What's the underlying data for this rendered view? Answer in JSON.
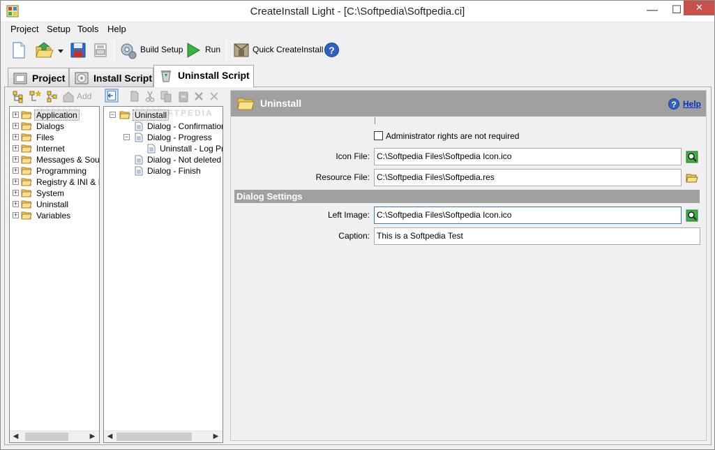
{
  "window": {
    "title": "CreateInstall Light - [C:\\Softpedia\\Softpedia.ci]",
    "min_glyph": "—",
    "max_glyph": "☐",
    "close_glyph": "✕"
  },
  "menu": [
    "Project",
    "Setup",
    "Tools",
    "Help"
  ],
  "toolbar": {
    "build_setup": "Build Setup",
    "run": "Run",
    "quick_createinstall": "Quick CreateInstall"
  },
  "tabs": [
    {
      "label": "Project",
      "active": false
    },
    {
      "label": "Install Script",
      "active": false
    },
    {
      "label": "Uninstall Script",
      "active": true
    }
  ],
  "left_toolbar": {
    "add_label": "Add"
  },
  "command_tree": [
    {
      "label": "Application",
      "selected": true
    },
    {
      "label": "Dialogs"
    },
    {
      "label": "Files"
    },
    {
      "label": "Internet"
    },
    {
      "label": "Messages & Sounds"
    },
    {
      "label": "Programming"
    },
    {
      "label": "Registry & INI & Environment"
    },
    {
      "label": "System"
    },
    {
      "label": "Uninstall"
    },
    {
      "label": "Variables"
    }
  ],
  "script_tree": {
    "root": "Uninstall",
    "watermark": "SOFTPEDIA",
    "items": [
      {
        "label": "Dialog - Confirmation",
        "level": 1
      },
      {
        "label": "Dialog - Progress",
        "level": 1
      },
      {
        "label": "Uninstall - Log Processing",
        "level": 2
      },
      {
        "label": "Dialog - Not deleted files",
        "level": 1
      },
      {
        "label": "Dialog - Finish",
        "level": 1
      }
    ]
  },
  "panel": {
    "title": "Uninstall",
    "help_link": "Help",
    "admin_checkbox": {
      "label": "Administrator rights are not required",
      "checked": false
    },
    "icon_file": {
      "label": "Icon File:",
      "value": "C:\\Softpedia Files\\Softpedia Icon.ico"
    },
    "resource_file": {
      "label": "Resource File:",
      "value": "C:\\Softpedia Files\\Softpedia.res"
    },
    "dialog_settings": {
      "title": "Dialog Settings",
      "left_image": {
        "label": "Left Image:",
        "value": "C:\\Softpedia Files\\Softpedia Icon.ico"
      },
      "caption": {
        "label": "Caption:",
        "value": "This is a Softpedia Test"
      }
    }
  },
  "colors": {
    "header_gray": "#a0a0a0",
    "close_red": "#c7504b",
    "help_blue": "#2f62c6",
    "link_blue": "#0033cc"
  }
}
